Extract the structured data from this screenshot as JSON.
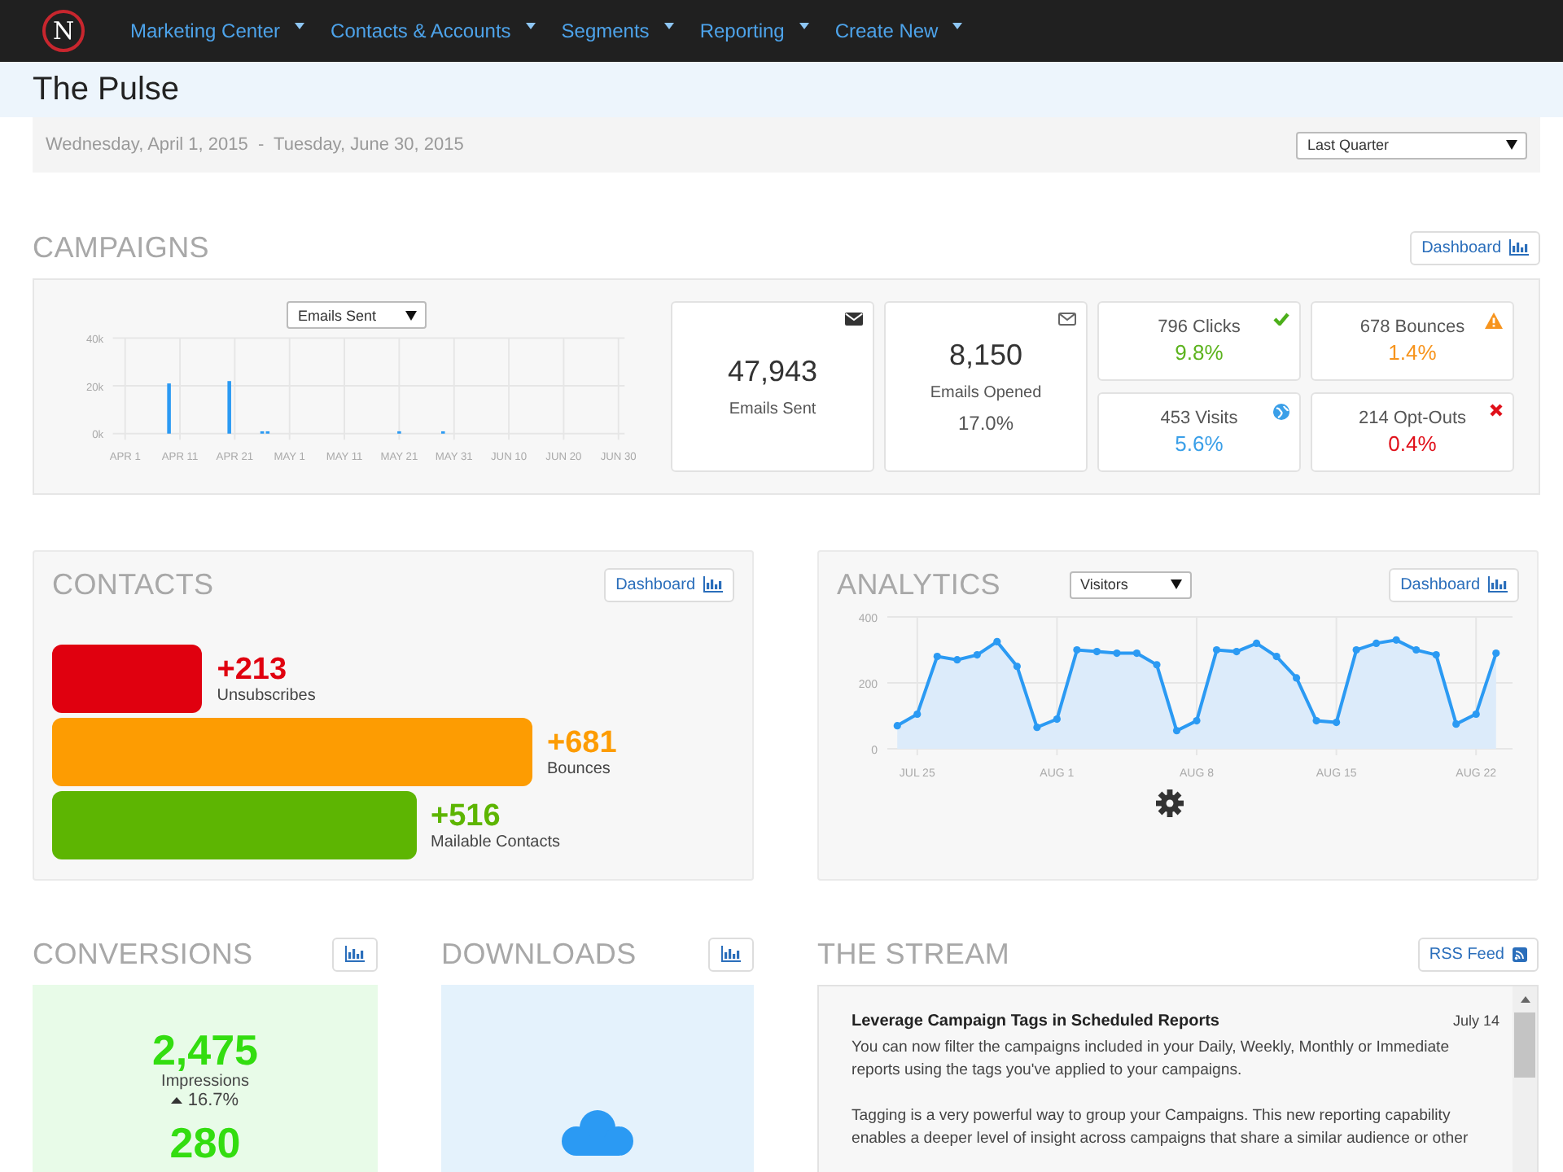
{
  "nav": {
    "logo": "N",
    "items": [
      {
        "label": "Marketing Center"
      },
      {
        "label": "Contacts & Accounts"
      },
      {
        "label": "Segments"
      },
      {
        "label": "Reporting"
      },
      {
        "label": "Create New"
      }
    ]
  },
  "page_title": "The Pulse",
  "date_range": {
    "text": "Wednesday, April 1, 2015  -  Tuesday, June 30, 2015",
    "select": "Last Quarter"
  },
  "campaigns": {
    "title": "CAMPAIGNS",
    "dashboard_button": "Dashboard",
    "metric_select": "Emails Sent",
    "chart_data": {
      "type": "bar",
      "categories": [
        "APR 1",
        null,
        null,
        null,
        null,
        null,
        null,
        null,
        null,
        null,
        "APR 11",
        null,
        null,
        null,
        null,
        null,
        null,
        null,
        null,
        null,
        "APR 21",
        null,
        null,
        null,
        null,
        null,
        null,
        null,
        null,
        null,
        "MAY 1",
        null,
        null,
        null,
        null,
        null,
        null,
        null,
        null,
        null,
        "MAY 11",
        null,
        null,
        null,
        null,
        null,
        null,
        null,
        null,
        null,
        "MAY 21",
        null,
        null,
        null,
        null,
        null,
        null,
        null,
        null,
        null,
        "MAY 31",
        null,
        null,
        null,
        null,
        null,
        null,
        null,
        null,
        null,
        "JUN 10",
        null,
        null,
        null,
        null,
        null,
        null,
        null,
        null,
        null,
        "JUN 20",
        null,
        null,
        null,
        null,
        null,
        null,
        null,
        null,
        null,
        "JUN 30"
      ],
      "values": [
        null,
        null,
        null,
        null,
        null,
        null,
        null,
        null,
        21000,
        null,
        null,
        null,
        null,
        null,
        null,
        null,
        null,
        null,
        null,
        22000,
        null,
        null,
        null,
        null,
        null,
        400,
        400,
        null,
        null,
        null,
        null,
        null,
        null,
        null,
        null,
        null,
        null,
        null,
        null,
        null,
        null,
        null,
        null,
        null,
        null,
        null,
        null,
        null,
        null,
        null,
        500,
        null,
        null,
        null,
        null,
        null,
        null,
        null,
        400,
        null,
        null,
        null,
        null,
        null,
        null,
        null,
        null,
        null,
        null,
        null,
        null,
        null,
        null,
        null,
        null,
        null,
        null,
        null,
        null,
        null,
        null,
        null,
        null,
        null,
        null,
        null,
        null,
        null,
        null,
        null,
        null
      ],
      "ylim": [
        0,
        40000
      ],
      "grid": true,
      "yticks": [
        {
          "value": 0,
          "label": "0k"
        },
        {
          "value": 20000,
          "label": "20k"
        },
        {
          "value": 40000,
          "label": "40k"
        }
      ],
      "color": "#2b9af3"
    },
    "tiles": [
      {
        "kind": "big",
        "value": "47,943",
        "label": "Emails Sent"
      },
      {
        "kind": "big",
        "value": "8,150",
        "label": "Emails Opened",
        "rate": "17.0%"
      },
      {
        "kind": "small",
        "label": "796 Clicks",
        "rate": "9.8%",
        "color": "#5cb31e"
      },
      {
        "kind": "small",
        "label": "678 Bounces",
        "rate": "1.4%",
        "color": "#f7941d"
      },
      {
        "kind": "small",
        "label": "453 Visits",
        "rate": "5.6%",
        "color": "#3a9fe8"
      },
      {
        "kind": "small",
        "label": "214 Opt-Outs",
        "rate": "0.4%",
        "color": "#e0101a"
      }
    ]
  },
  "contacts": {
    "title": "CONTACTS",
    "dashboard_button": "Dashboard",
    "bars": [
      {
        "value": "+213",
        "label": "Unsubscribes",
        "color": "#e0000f"
      },
      {
        "value": "+681",
        "label": "Bounces",
        "color": "#fd9c02"
      },
      {
        "value": "+516",
        "label": "Mailable Contacts",
        "color": "#5db502"
      }
    ]
  },
  "analytics": {
    "title": "ANALYTICS",
    "metric_select": "Visitors",
    "dashboard_button": "Dashboard",
    "chart_data": {
      "type": "area",
      "categories": [
        null,
        "JUL 25",
        null,
        null,
        null,
        null,
        null,
        null,
        "AUG 1",
        null,
        null,
        null,
        null,
        null,
        null,
        "AUG 8",
        null,
        null,
        null,
        null,
        null,
        null,
        "AUG 15",
        null,
        null,
        null,
        null,
        null,
        null,
        "AUG 22",
        null
      ],
      "grid": true,
      "series": [
        {
          "color": "#2b9af3",
          "values": [
            70,
            105,
            280,
            270,
            285,
            325,
            250,
            65,
            90,
            300,
            295,
            290,
            290,
            255,
            55,
            85,
            300,
            295,
            320,
            280,
            215,
            85,
            80,
            300,
            320,
            330,
            300,
            285,
            75,
            105,
            290
          ]
        }
      ],
      "ylim": [
        0,
        400
      ],
      "yticks": [
        0,
        200,
        400
      ]
    }
  },
  "conversions": {
    "title": "CONVERSIONS",
    "stats": [
      {
        "value": "2,475",
        "label": "Impressions",
        "change": "16.7%"
      },
      {
        "value": "280"
      }
    ]
  },
  "downloads": {
    "title": "DOWNLOADS"
  },
  "stream": {
    "title": "THE STREAM",
    "rss_button": "RSS Feed",
    "posts": [
      {
        "title": "Leverage Campaign Tags in Scheduled Reports",
        "date": "July 14",
        "paragraphs": [
          "You can now filter the campaigns included in your Daily, Weekly, Monthly or Immediate reports using the tags you've applied to your campaigns.",
          "Tagging is a very powerful way to group your Campaigns. This new reporting capability enables a deeper level of insight across campaigns that share a similar audience or other"
        ]
      }
    ]
  }
}
